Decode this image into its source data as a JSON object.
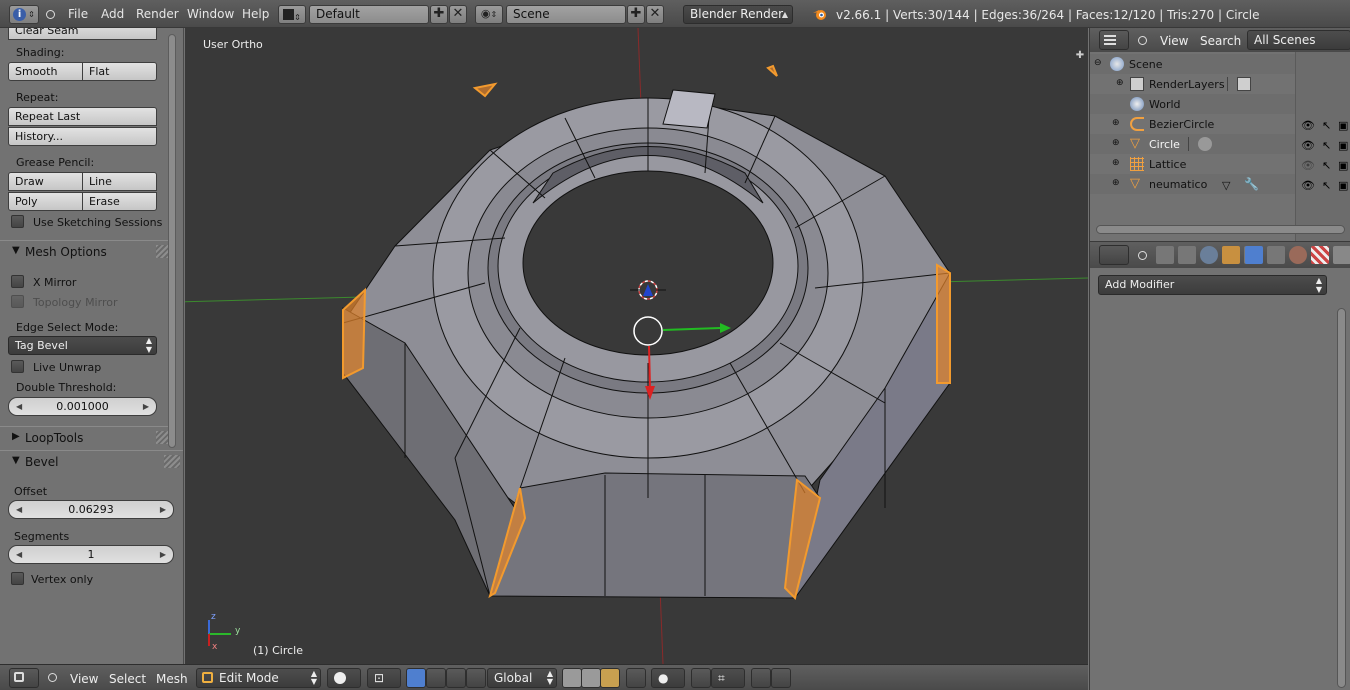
{
  "topbar": {
    "menus": [
      "File",
      "Add",
      "Render",
      "Window",
      "Help"
    ],
    "screen_layout": "Default",
    "scene": "Scene",
    "render_engine": "Blender Render",
    "stats": "v2.66.1 | Verts:30/144 | Edges:36/264 | Faces:12/120 | Tris:270 | Circle"
  },
  "toolshelf": {
    "clear_seam": "Clear Seam",
    "shading_label": "Shading:",
    "smooth": "Smooth",
    "flat": "Flat",
    "repeat_label": "Repeat:",
    "repeat_last": "Repeat Last",
    "history": "History...",
    "grease_label": "Grease Pencil:",
    "draw": "Draw",
    "line": "Line",
    "poly": "Poly",
    "erase": "Erase",
    "sketching": "Use Sketching Sessions",
    "mesh_options": "Mesh Options",
    "x_mirror": "X Mirror",
    "topology_mirror": "Topology Mirror",
    "edge_select_label": "Edge Select Mode:",
    "edge_select_value": "Tag Bevel",
    "live_unwrap": "Live Unwrap",
    "double_threshold_label": "Double Threshold:",
    "double_threshold": "0.001000",
    "looptools": "LoopTools",
    "bevel": "Bevel",
    "offset_label": "Offset",
    "offset": "0.06293",
    "segments_label": "Segments",
    "segments": "1",
    "vertex_only": "Vertex only"
  },
  "viewport": {
    "view_name": "User Ortho",
    "object_label": "(1) Circle",
    "axis_x": "y",
    "axis_z": "z",
    "axis_y": "x"
  },
  "bottombar": {
    "menus": [
      "View",
      "Select",
      "Mesh"
    ],
    "mode": "Edit Mode",
    "orientation": "Global"
  },
  "outliner": {
    "menus": [
      "View",
      "Search"
    ],
    "filter": "All Scenes",
    "items": [
      {
        "name": "Scene"
      },
      {
        "name": "RenderLayers"
      },
      {
        "name": "World"
      },
      {
        "name": "BezierCircle"
      },
      {
        "name": "Circle"
      },
      {
        "name": "Lattice"
      },
      {
        "name": "neumatico"
      }
    ]
  },
  "properties": {
    "add_modifier": "Add Modifier"
  },
  "colors": {
    "selected_edge": "#f29a2e",
    "selected_name": "#f0f0f0",
    "mesh_face": "#9a9aa2",
    "viewport_bg": "#393939"
  }
}
